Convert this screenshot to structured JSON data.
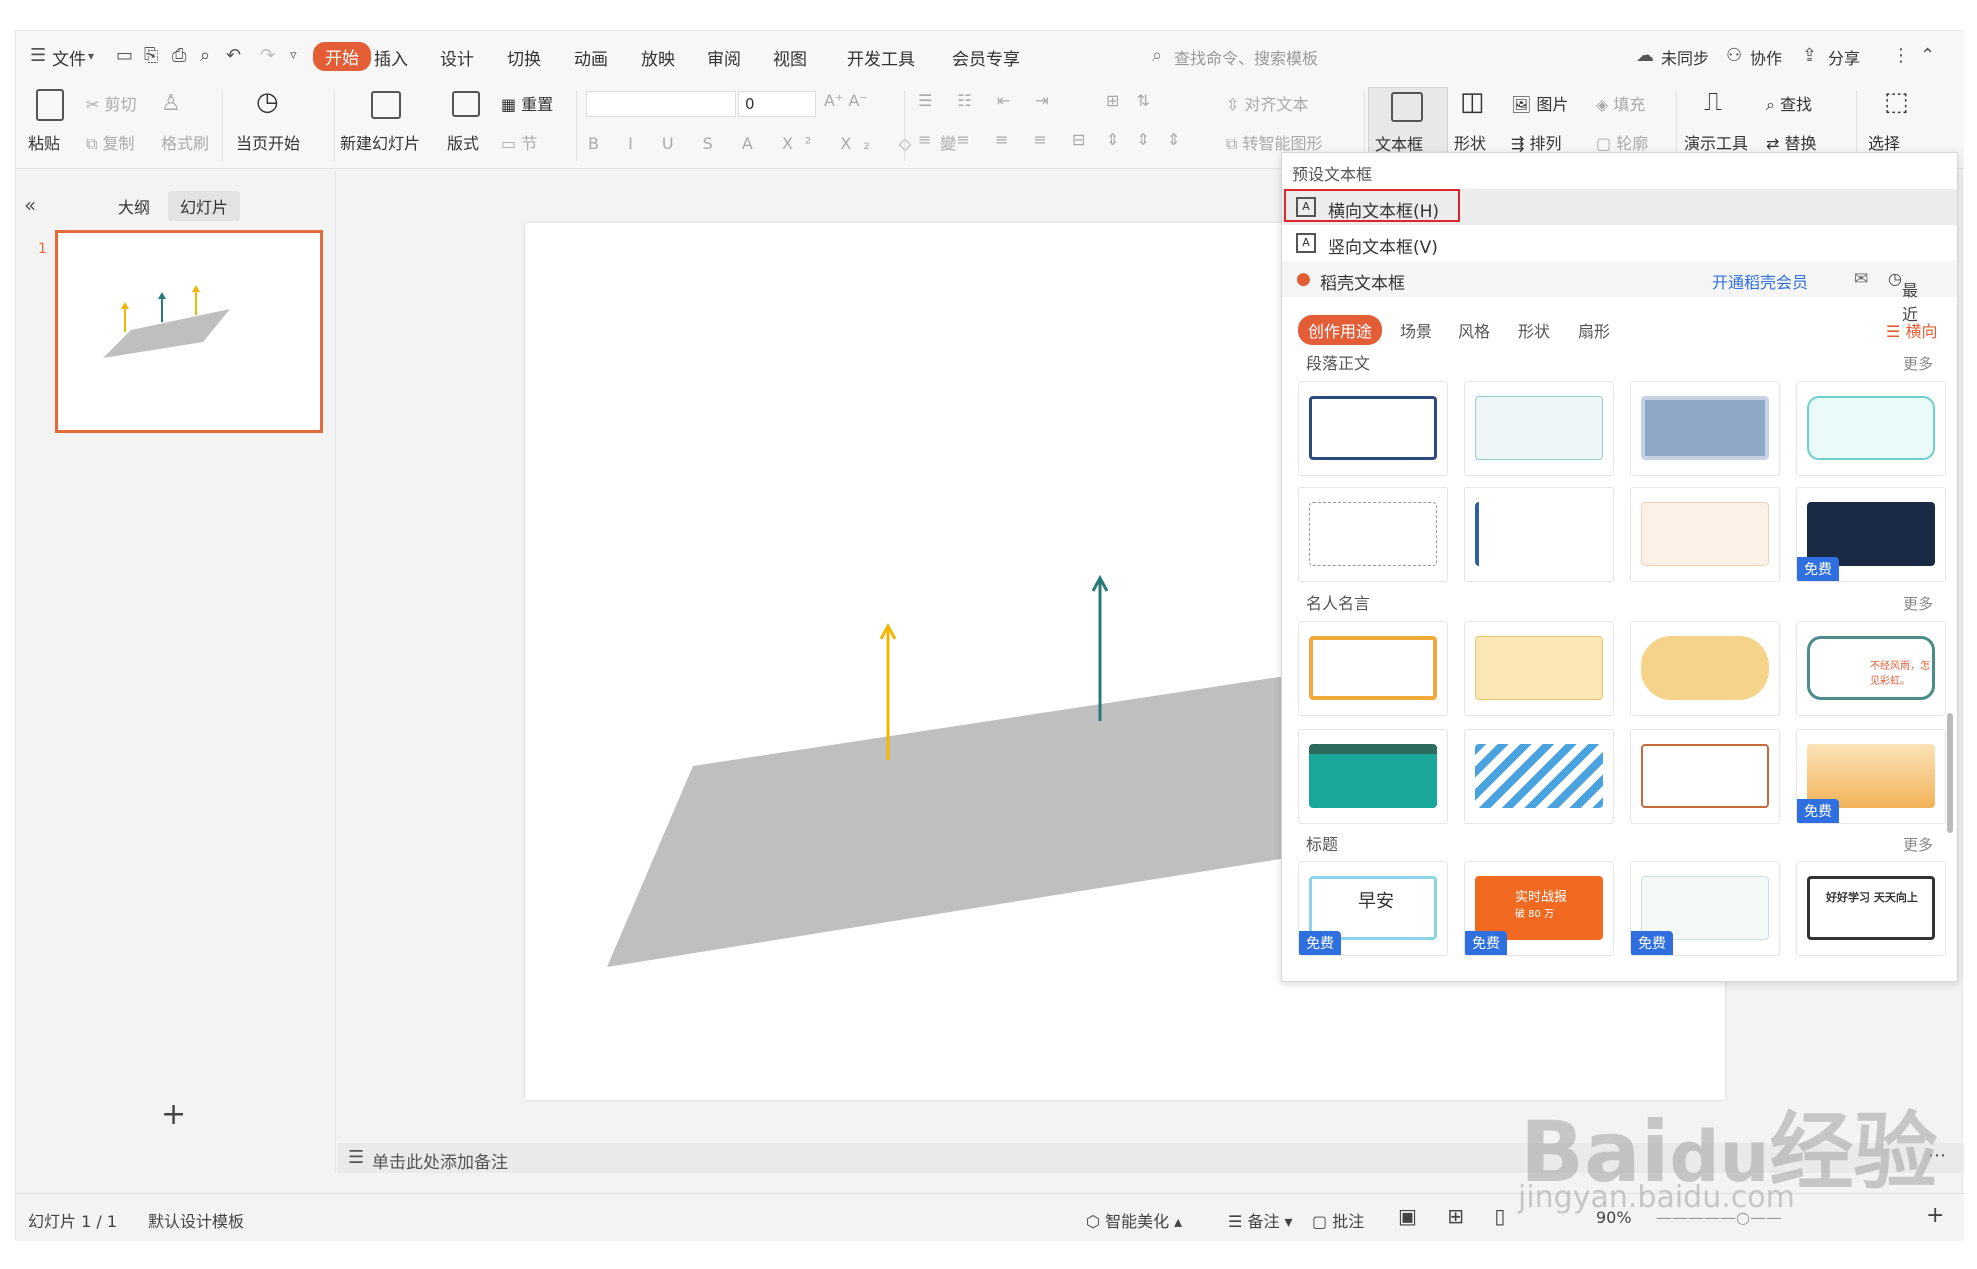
{
  "menu": {
    "file": "文件",
    "tabs": [
      "开始",
      "插入",
      "设计",
      "切换",
      "动画",
      "放映",
      "审阅",
      "视图",
      "开发工具",
      "会员专享"
    ],
    "search_placeholder": "查找命令、搜索模板",
    "right": [
      "未同步",
      "协作",
      "分享"
    ]
  },
  "ribbon": {
    "paste": "粘贴",
    "cut": "剪切",
    "copy": "复制",
    "format_painter": "格式刷",
    "from_current": "当页开始",
    "new_slide": "新建幻灯片",
    "layout": "版式",
    "reset": "重置",
    "section": "节",
    "font_size": "0",
    "align_text": "对齐文本",
    "convert_smartart": "转智能图形",
    "textbox": "文本框",
    "shape": "形状",
    "picture": "图片",
    "arrange": "排列",
    "fill": "填充",
    "outline": "轮廓",
    "presenter_tools": "演示工具",
    "find": "查找",
    "replace": "替换",
    "select": "选择"
  },
  "left_pane": {
    "outline_tab": "大纲",
    "slides_tab": "幻灯片",
    "slide_number": "1"
  },
  "notes_placeholder": "单击此处添加备注",
  "status": {
    "slide_info": "幻灯片 1 / 1",
    "template": "默认设计模板",
    "beautify": "智能美化",
    "notes": "备注",
    "comments": "批注",
    "zoom": "90%"
  },
  "dropdown": {
    "preset_header": "预设文本框",
    "horizontal": "横向文本框(H)",
    "vertical": "竖向文本框(V)",
    "docer_textbox": "稻壳文本框",
    "open_member": "开通稻壳会员",
    "recent": "最近",
    "chips": [
      "创作用途",
      "场景",
      "风格",
      "形状",
      "扇形"
    ],
    "orientation": "横向",
    "sections": [
      "段落正文",
      "名人名言",
      "标题"
    ],
    "more": "更多",
    "free": "免费",
    "card_texts": {
      "motto1": "不经风雨，怎见彩虹。",
      "morning": "早安",
      "battle": "实时战报",
      "battle_sub": "破 80 万",
      "study1": "好好学习",
      "study2": "天天向上"
    }
  },
  "watermark": {
    "brand": "Bai",
    "brand2": "经验",
    "url": "jingyan.baidu.com"
  },
  "colors": {
    "accent": "#e35d37",
    "highlight_box": "#e0262d",
    "arrow_yellow": "#f2b705",
    "arrow_teal": "#2a7a7a",
    "shape_gray": "#bfbfbf",
    "free_badge": "#2f6fe0"
  }
}
